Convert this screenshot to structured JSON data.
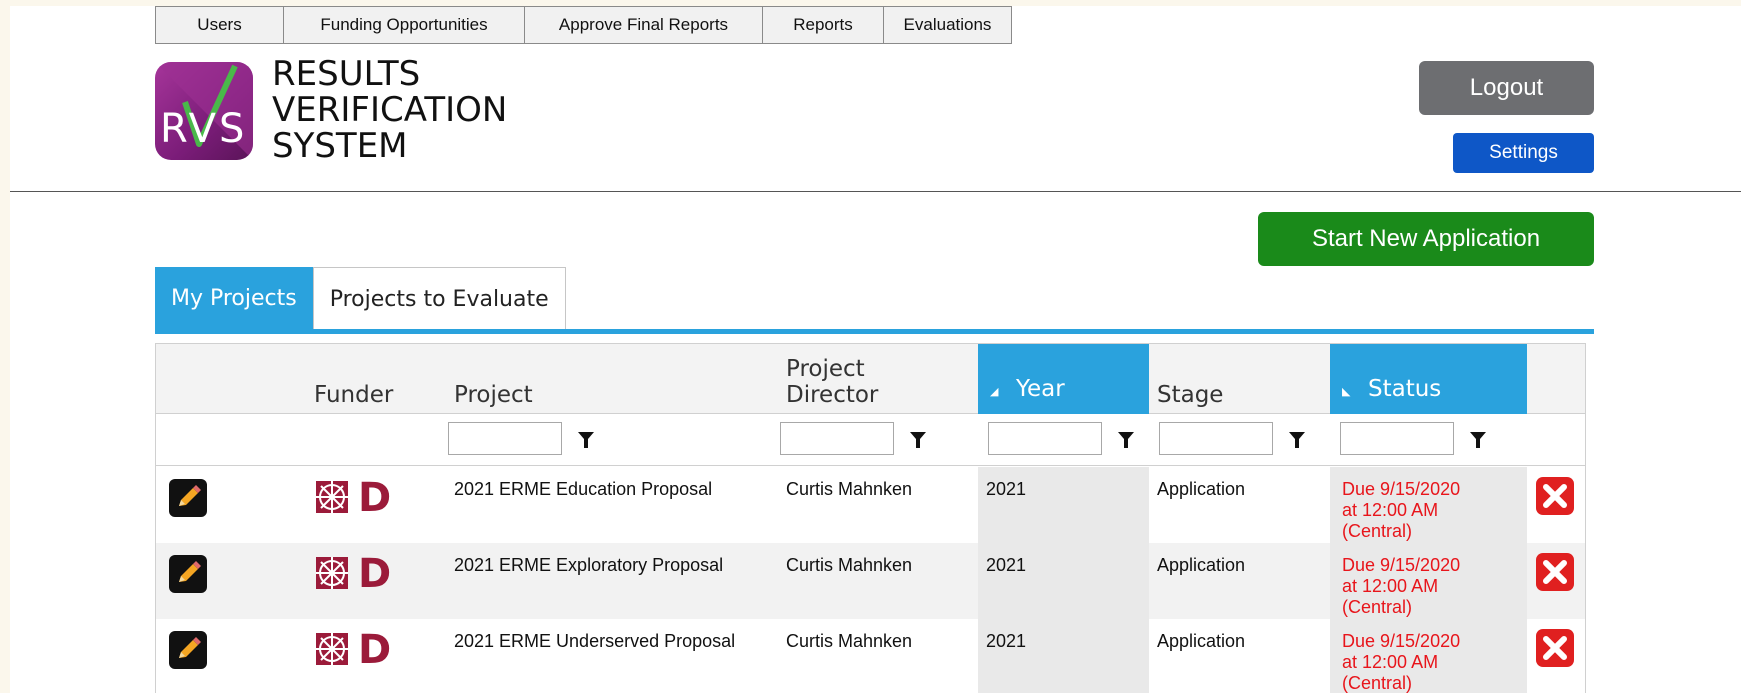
{
  "nav": {
    "items": [
      {
        "label": "Users"
      },
      {
        "label": "Funding Opportunities"
      },
      {
        "label": "Approve Final Reports"
      },
      {
        "label": "Reports"
      },
      {
        "label": "Evaluations"
      }
    ]
  },
  "brand": {
    "logo_letters": "RVS",
    "line1": "RESULTS",
    "line2": "VERIFICATION",
    "line3": "SYSTEM",
    "colors": {
      "logo": "#8e2a8a",
      "check": "#4ab84a"
    }
  },
  "header": {
    "logout_label": "Logout",
    "settings_label": "Settings",
    "start_label": "Start New Application",
    "colors": {
      "logout": "#6d6e71",
      "settings": "#0e57c7",
      "start": "#1a8a1a"
    }
  },
  "tabs": [
    {
      "label": "My Projects",
      "active": true
    },
    {
      "label": "Projects to Evaluate",
      "active": false
    }
  ],
  "table": {
    "columns": {
      "funder": "Funder",
      "project": "Project",
      "director_1": "Project",
      "director_2": "Director",
      "year": "Year",
      "stage": "Stage",
      "status": "Status"
    },
    "filters": {
      "project": "",
      "director": "",
      "year": "",
      "stage": "",
      "status": ""
    },
    "rows": [
      {
        "project": "2021 ERME Education Proposal",
        "director": "Curtis Mahnken",
        "year": "2021",
        "stage": "Application",
        "status_1": "Due 9/15/2020",
        "status_2": "at 12:00 AM",
        "status_3": "(Central)"
      },
      {
        "project": "2021 ERME Exploratory Proposal",
        "director": "Curtis Mahnken",
        "year": "2021",
        "stage": "Application",
        "status_1": "Due 9/15/2020",
        "status_2": "at 12:00 AM",
        "status_3": "(Central)"
      },
      {
        "project": "2021 ERME Underserved Proposal",
        "director": "Curtis Mahnken",
        "year": "2021",
        "stage": "Application",
        "status_1": "Due 9/15/2020",
        "status_2": "at 12:00 AM",
        "status_3": "(Central)"
      }
    ],
    "funder_mark_letter": "D",
    "icons": {
      "edit": "pencil-icon",
      "delete": "close-icon",
      "filter": "filter-icon",
      "funder": "wheel-icon"
    },
    "colors": {
      "status": "#e8151b",
      "funder": "#9b1b3a",
      "sorted_header": "#2aa2dd"
    }
  }
}
